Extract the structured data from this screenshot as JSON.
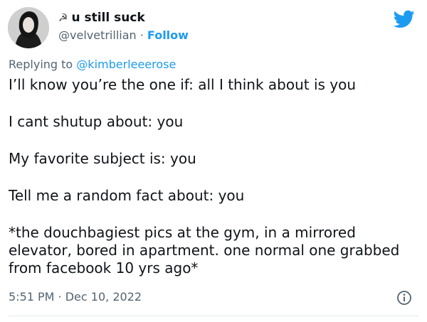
{
  "tweet": {
    "author": {
      "name_emoji": "☭",
      "display_name": "u still suck",
      "handle": "@velvetrillian",
      "separator": " · ",
      "follow_label": "Follow"
    },
    "reply": {
      "prefix": "Replying to ",
      "mention": "@kimberleeerose"
    },
    "lines": [
      "I’ll know you’re the one if: all I think about is you",
      "I cant shutup about: you",
      "My favorite subject is: you",
      "Tell me a random fact about: you",
      "*the douchbagiest pics at the gym, in a mirrored elevator, bored in apartment. one normal one grabbed from facebook 10 yrs ago*"
    ],
    "time": "5:51 PM",
    "time_separator": " · ",
    "date": "Dec 10, 2022"
  },
  "icons": {
    "brand": "twitter-bird-icon",
    "info": "info-icon"
  },
  "colors": {
    "brand_blue": "#1d9bf0",
    "text_primary": "#0f1419",
    "text_secondary": "#536471"
  }
}
